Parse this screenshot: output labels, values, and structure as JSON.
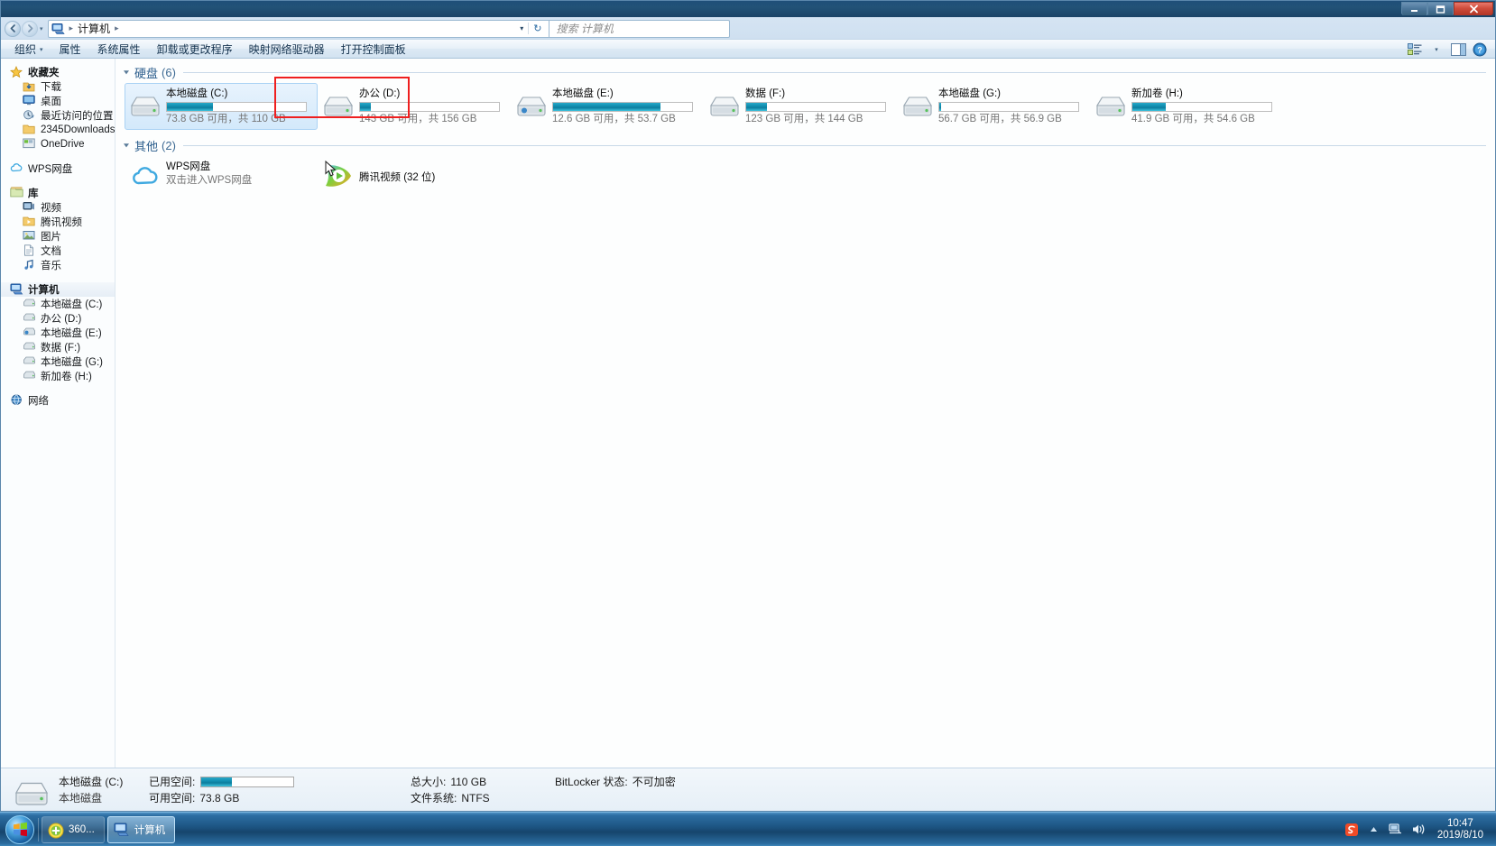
{
  "window": {
    "title": "计算机",
    "controls": {
      "minimize": "–",
      "maximize": "❐",
      "close": "✕"
    }
  },
  "address": {
    "back_icon": "back-icon",
    "forward_icon": "forward-icon",
    "history_caret": "▾",
    "crumb_root": "计算机",
    "separator": "▸",
    "dropdown_caret": "▾",
    "refresh_icon": "↻"
  },
  "search": {
    "placeholder": "搜索 计算机",
    "value": ""
  },
  "toolbar": {
    "items": [
      {
        "label": "组织",
        "has_caret": true
      },
      {
        "label": "属性",
        "has_caret": false
      },
      {
        "label": "系统属性",
        "has_caret": false
      },
      {
        "label": "卸载或更改程序",
        "has_caret": false
      },
      {
        "label": "映射网络驱动器",
        "has_caret": false
      },
      {
        "label": "打开控制面板",
        "has_caret": false
      }
    ],
    "view_icon": "view-layout-icon",
    "view_caret": "▾",
    "preview_icon": "preview-pane-icon",
    "help_icon": "help-icon"
  },
  "sidebar": {
    "groups": [
      {
        "name": "收藏夹",
        "icon": "star-icon",
        "items": [
          {
            "label": "下载",
            "icon": "downloads-icon"
          },
          {
            "label": "桌面",
            "icon": "desktop-icon"
          },
          {
            "label": "最近访问的位置",
            "icon": "recent-places-icon"
          },
          {
            "label": "2345Downloads",
            "icon": "folder-icon"
          },
          {
            "label": "OneDrive",
            "icon": "onedrive-icon"
          }
        ]
      },
      {
        "name": "WPS网盘",
        "icon": "cloud-icon",
        "items": []
      },
      {
        "name": "库",
        "icon": "library-icon",
        "items": [
          {
            "label": "视频",
            "icon": "video-icon"
          },
          {
            "label": "腾讯视频",
            "icon": "folder-video-icon"
          },
          {
            "label": "图片",
            "icon": "pictures-icon"
          },
          {
            "label": "文档",
            "icon": "documents-icon"
          },
          {
            "label": "音乐",
            "icon": "music-icon"
          }
        ]
      },
      {
        "name": "计算机",
        "icon": "computer-icon",
        "selected": true,
        "items": [
          {
            "label": "本地磁盘 (C:)",
            "icon": "drive-icon"
          },
          {
            "label": "办公 (D:)",
            "icon": "drive-icon"
          },
          {
            "label": "本地磁盘 (E:)",
            "icon": "drive-icon"
          },
          {
            "label": "数据 (F:)",
            "icon": "drive-icon"
          },
          {
            "label": "本地磁盘 (G:)",
            "icon": "drive-icon"
          },
          {
            "label": "新加卷 (H:)",
            "icon": "drive-icon"
          }
        ]
      },
      {
        "name": "网络",
        "icon": "network-icon",
        "items": []
      }
    ]
  },
  "content": {
    "groups": [
      {
        "title": "硬盘",
        "count": "(6)",
        "triangle": "◢"
      },
      {
        "title": "其他",
        "count": "(2)",
        "triangle": "◢"
      }
    ],
    "drives": [
      {
        "name": "本地磁盘 (C:)",
        "free": "73.8 GB",
        "total": "110 GB",
        "sub": "73.8 GB 可用，共 110 GB",
        "used_pct": 33,
        "bar_color": "teal",
        "selected": true
      },
      {
        "name": "办公 (D:)",
        "free": "143 GB",
        "total": "156 GB",
        "sub": "143 GB 可用，共 156 GB",
        "used_pct": 8,
        "bar_color": "teal",
        "selected": false
      },
      {
        "name": "本地磁盘 (E:)",
        "free": "12.6 GB",
        "total": "53.7 GB",
        "sub": "12.6 GB 可用，共 53.7 GB",
        "used_pct": 77,
        "bar_color": "teal",
        "selected": false
      },
      {
        "name": "数据 (F:)",
        "free": "123 GB",
        "total": "144 GB",
        "sub": "123 GB 可用，共 144 GB",
        "used_pct": 15,
        "bar_color": "teal",
        "selected": false
      },
      {
        "name": "本地磁盘 (G:)",
        "free": "56.7 GB",
        "total": "56.9 GB",
        "sub": "56.7 GB 可用，共 56.9 GB",
        "used_pct": 1,
        "bar_color": "teal",
        "selected": false
      },
      {
        "name": "新加卷 (H:)",
        "free": "41.9 GB",
        "total": "54.6 GB",
        "sub": "41.9 GB 可用，共 54.6 GB",
        "used_pct": 24,
        "bar_color": "teal",
        "selected": false
      }
    ],
    "others": [
      {
        "name": "WPS网盘",
        "sub": "双击进入WPS网盘",
        "icon": "wps-cloud-icon"
      },
      {
        "name": "腾讯视频 (32 位)",
        "sub": "",
        "icon": "tencent-video-icon"
      }
    ]
  },
  "details": {
    "title": "本地磁盘 (C:)",
    "subtitle": "本地磁盘",
    "used_label": "已用空间:",
    "free_label": "可用空间:",
    "free_value": "73.8 GB",
    "total_label": "总大小:",
    "total_value": "110 GB",
    "fs_label": "文件系统:",
    "fs_value": "NTFS",
    "bitlocker_label": "BitLocker 状态:",
    "bitlocker_value": "不可加密",
    "used_pct": 33
  },
  "taskbar": {
    "start_label": "start-orb",
    "items": [
      {
        "label": "360...",
        "icon": "360-icon",
        "active": false
      },
      {
        "label": "计算机",
        "icon": "computer-window-icon",
        "active": true
      }
    ],
    "tray": [
      {
        "icon": "sogou-input-icon"
      },
      {
        "icon": "show-hidden-icons-icon"
      },
      {
        "icon": "network-tray-icon"
      },
      {
        "icon": "volume-tray-icon"
      }
    ],
    "clock_time": "10:47",
    "clock_date": "2019/8/10"
  },
  "colors": {
    "accent": "#1392b4",
    "highlight_box": "#ef1f1f",
    "titlebar": "#1f4f79",
    "taskbar": "#1d5583"
  }
}
